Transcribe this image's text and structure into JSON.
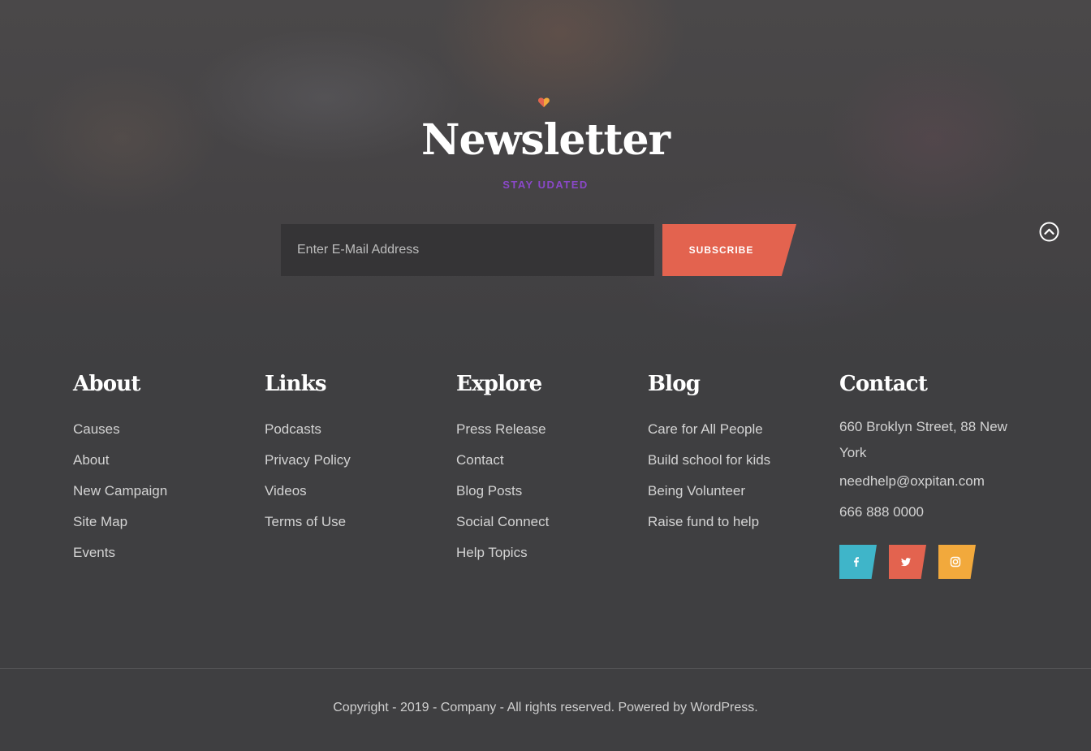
{
  "newsletter": {
    "title": "Newsletter",
    "subtitle": "STAY UDATED",
    "email_placeholder": "Enter E-Mail Address",
    "subscribe_label": "SUBSCRIBE",
    "subtitle_color": "#8a48c9",
    "button_color": "#e3634f",
    "heart_icon": "heart-icon"
  },
  "footer": {
    "about": {
      "title": "About",
      "items": [
        "Causes",
        "About",
        "New Campaign",
        "Site Map",
        "Events"
      ]
    },
    "links": {
      "title": "Links",
      "items": [
        "Podcasts",
        "Privacy Policy",
        "Videos",
        "Terms of Use"
      ]
    },
    "explore": {
      "title": "Explore",
      "items": [
        "Press Release",
        "Contact",
        "Blog Posts",
        "Social Connect",
        "Help Topics"
      ]
    },
    "blog": {
      "title": "Blog",
      "items": [
        "Care for All People",
        "Build school for kids",
        "Being Volunteer",
        "Raise fund to help"
      ]
    },
    "contact": {
      "title": "Contact",
      "address": "660 Broklyn Street, 88 New York",
      "email": "needhelp@oxpitan.com",
      "phone": "666 888 0000"
    },
    "socials": [
      {
        "icon": "facebook-icon",
        "color": "#3fb5c9"
      },
      {
        "icon": "twitter-icon",
        "color": "#e3634f"
      },
      {
        "icon": "instagram-icon",
        "color": "#f2a93c"
      }
    ]
  },
  "copyright": "Copyright - 2019 - Company - All rights reserved. Powered by WordPress."
}
